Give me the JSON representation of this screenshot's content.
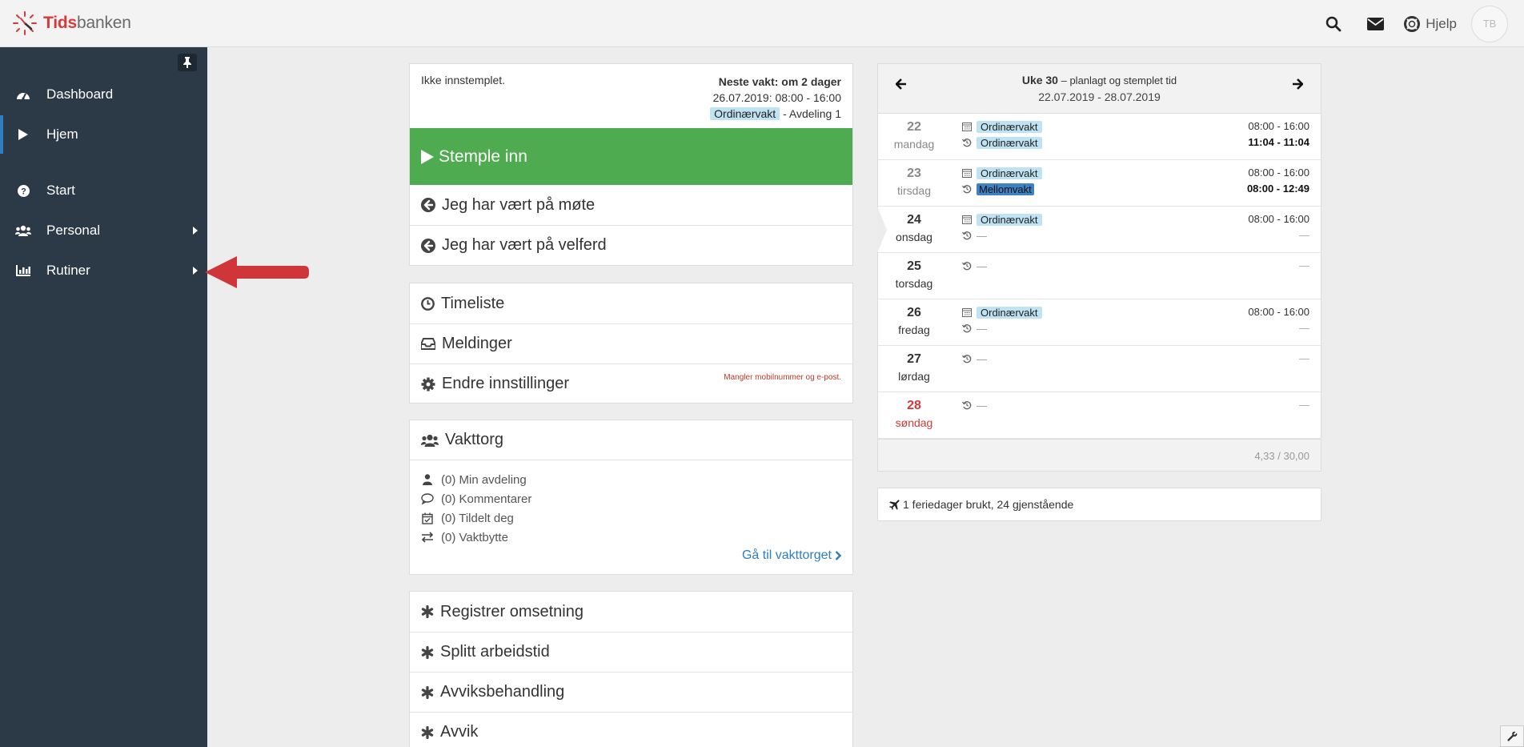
{
  "header": {
    "logo_part1": "Tids",
    "logo_part2": "banken",
    "help_label": "Hjelp",
    "avatar_initials": "TB"
  },
  "sidebar": {
    "items": [
      {
        "label": "Dashboard",
        "icon": "dashboard-icon"
      },
      {
        "label": "Hjem",
        "icon": "play-icon"
      },
      {
        "label": "Start",
        "icon": "question-circle-icon"
      },
      {
        "label": "Personal",
        "icon": "users-icon"
      },
      {
        "label": "Rutiner",
        "icon": "bar-chart-icon"
      }
    ]
  },
  "status": {
    "not_clocked_in": "Ikke innstemplet.",
    "next_shift_label": "Neste vakt: om 2 dager",
    "next_shift_time": "26.07.2019: 08:00 - 16:00",
    "next_shift_type": "Ordinærvakt",
    "next_shift_dept": "- Avdeling 1",
    "clock_in_label": "Stemple inn",
    "meeting_label": "Jeg har vært på møte",
    "welfare_label": "Jeg har vært på velferd"
  },
  "links": {
    "timesheet": "Timeliste",
    "messages": "Meldinger",
    "settings": "Endre innstillinger",
    "settings_warning": "Mangler mobilnummer og e-post."
  },
  "vakttorg": {
    "title": "Vakttorg",
    "items": [
      "(0) Min avdeling",
      "(0) Kommentarer",
      "(0) Tildelt deg",
      "(0) Vaktbytte"
    ],
    "link": "Gå til vakttorget"
  },
  "actions": [
    "Registrer omsetning",
    "Splitt arbeidstid",
    "Avviksbehandling",
    "Avvik"
  ],
  "week": {
    "title_bold": "Uke 30",
    "title_rest": "– planlagt og stemplet tid",
    "range": "22.07.2019 - 28.07.2019",
    "days": [
      {
        "num": "22",
        "name": "mandag",
        "planned": "Ordinærvakt",
        "planned_time": "08:00 - 16:00",
        "clocked": "Ordinærvakt",
        "clocked_time": "11:04 - 11:04"
      },
      {
        "num": "23",
        "name": "tirsdag",
        "planned": "Ordinærvakt",
        "planned_time": "08:00 - 16:00",
        "clocked": "Mellomvakt",
        "clocked_time": "08:00 - 12:49"
      },
      {
        "num": "24",
        "name": "onsdag",
        "planned": "Ordinærvakt",
        "planned_time": "08:00 - 16:00",
        "clocked": "—",
        "clocked_time": "—"
      },
      {
        "num": "25",
        "name": "torsdag",
        "clocked": "—",
        "clocked_time": "—"
      },
      {
        "num": "26",
        "name": "fredag",
        "planned": "Ordinærvakt",
        "planned_time": "08:00 - 16:00",
        "clocked": "—",
        "clocked_time": "—"
      },
      {
        "num": "27",
        "name": "lørdag",
        "clocked": "—",
        "clocked_time": "—"
      },
      {
        "num": "28",
        "name": "søndag",
        "clocked": "—",
        "clocked_time": "—"
      }
    ],
    "total": "4,33 / 30,00"
  },
  "vacation": "1 feriedager brukt, 24 gjenstående",
  "colors": {
    "sidebar_bg": "#2c3a47",
    "green": "#4eab4f",
    "accent_blue": "#2f7ec1",
    "arrow_red": "#d0353a",
    "tag_light": "#bfe3f2",
    "tag_dark": "#3e82c3"
  }
}
